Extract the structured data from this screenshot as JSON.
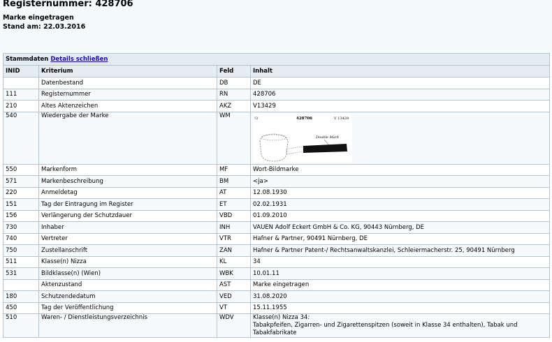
{
  "header": {
    "title": "Registernummer: 428706",
    "status": "Marke eingetragen",
    "date": "Stand am: 22.03.2016"
  },
  "table": {
    "caption": "Stammdaten",
    "caption_link": "Details schließen",
    "columns": [
      "INID",
      "Kriterium",
      "Feld",
      "Inhalt"
    ],
    "rows": [
      {
        "inid": "",
        "kriterium": "Datenbestand",
        "feld": "DB",
        "inhalt": "DE"
      },
      {
        "inid": "111",
        "kriterium": "Registernummer",
        "feld": "RN",
        "inhalt": "428706"
      },
      {
        "inid": "210",
        "kriterium": "Altes Aktenzeichen",
        "feld": "AKZ",
        "inhalt": "V13429"
      },
      {
        "inid": "540",
        "kriterium": "Wiedergabe der Marke",
        "feld": "WM",
        "inhalt": ""
      },
      {
        "inid": "550",
        "kriterium": "Markenform",
        "feld": "MF",
        "inhalt": "Wort-Bildmarke"
      },
      {
        "inid": "571",
        "kriterium": "Markenbeschreibung",
        "feld": "BM",
        "inhalt": "<ja>"
      },
      {
        "inid": "220",
        "kriterium": "Anmeldetag",
        "feld": "AT",
        "inhalt": "12.08.1930"
      },
      {
        "inid": "151",
        "kriterium": "Tag der Eintragung im Register",
        "feld": "ET",
        "inhalt": "02.02.1931"
      },
      {
        "inid": "156",
        "kriterium": "Verlängerung der Schutzdauer",
        "feld": "VBD",
        "inhalt": "01.09.2010"
      },
      {
        "inid": "730",
        "kriterium": "Inhaber",
        "feld": "INH",
        "inhalt": "VAUEN Adolf Eckert GmbH & Co. KG, 90443 Nürnberg, DE"
      },
      {
        "inid": "740",
        "kriterium": "Vertreter",
        "feld": "VTR",
        "inhalt": "Hafner & Partner, 90491 Nürnberg, DE"
      },
      {
        "inid": "750",
        "kriterium": "Zustellanschrift",
        "feld": "ZAN",
        "inhalt": "Hafner & Partner Patent-/ Rechtsanwaltskanzlei, Schleiermacherstr. 25, 90491 Nürnberg"
      },
      {
        "inid": "511",
        "kriterium": "Klasse(n) Nizza",
        "feld": "KL",
        "inhalt": "34"
      },
      {
        "inid": "531",
        "kriterium": "Bildklasse(n) (Wien)",
        "feld": "WBK",
        "inhalt": "10.01.11"
      },
      {
        "inid": "",
        "kriterium": "Aktenzustand",
        "feld": "AST",
        "inhalt": "Marke eingetragen"
      },
      {
        "inid": "180",
        "kriterium": "Schutzendedatum",
        "feld": "VED",
        "inhalt": "31.08.2020"
      },
      {
        "inid": "450",
        "kriterium": "Tag der Veröffentlichung",
        "feld": "VT",
        "inhalt": "15.11.1955"
      },
      {
        "inid": "510",
        "kriterium": "Waren- / Dienstleistungsverzeichnis",
        "feld": "WDV",
        "inhalt": "Klasse(n) Nizza 34:",
        "inhalt2": "Tabakpfeifen, Zigarren- und Zigarettenspitzen (soweit in Klasse 34 enthalten), Tabak und Tabakfabrikate"
      }
    ]
  },
  "mark_image": {
    "corner": "!3",
    "number": "428706",
    "file": "V 13429",
    "label": "Double Mark",
    "icon": "tobacco-pipe-drawing"
  }
}
